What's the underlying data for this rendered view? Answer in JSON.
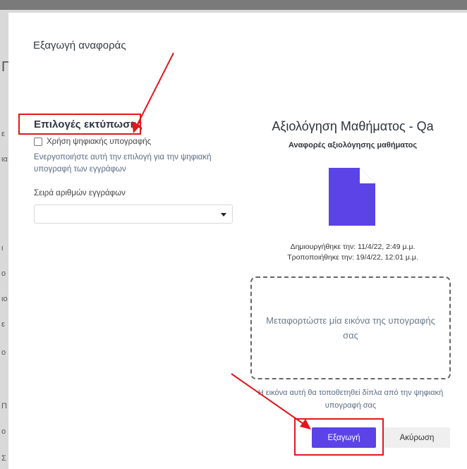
{
  "dialog": {
    "title": "Εξαγωγή αναφοράς"
  },
  "left_panel": {
    "section_title": "Επιλογές εκτύπωσης",
    "checkbox_label": "Χρήση ψηφιακής υπογραφής",
    "checkbox_checked": false,
    "help_text": "Ενεργοποιήστε αυτή την επιλογή για την ψηφιακή υπογραφή των εγγράφων",
    "select_label": "Σειρά αριθμών εγγράφων",
    "select_value": ""
  },
  "right_panel": {
    "report_title": "Αξιολόγηση Μαθήματος - Qa",
    "report_subtitle": "Αναφορές αξιολόγησης μαθήματος",
    "created": "Δημιουργήθηκε την: 11/4/22, 2:49 μ.μ.",
    "modified": "Τροποποιήθηκε την: 19/4/22, 12:01 μ.μ.",
    "upload_prompt": "Μεταφορτώστε μία εικόνα της υπογραφής σας",
    "upload_caption": "Η εικόνα αυτή θα τοποθετηθεί δίπλα από την ψηφιακή υπογραφή σας"
  },
  "buttons": {
    "export": "Εξαγωγή",
    "cancel": "Ακύρωση"
  },
  "background_fragments": [
    "Π",
    "ε",
    "ια",
    "ι",
    "ο",
    "ιο",
    "ε",
    "ο",
    "Π",
    "ο",
    "Σ"
  ],
  "colors": {
    "accent": "#5b43e8",
    "annotation": "#e5151b",
    "overlay": "#7a7a7a"
  },
  "icons": [
    "document-icon",
    "chevron-down-icon",
    "checkbox-icon"
  ]
}
